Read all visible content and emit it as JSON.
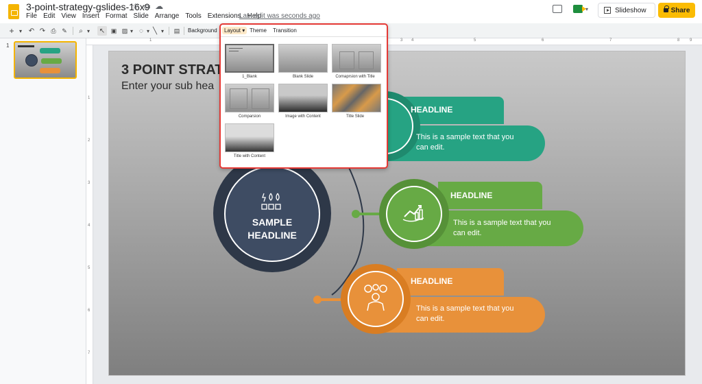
{
  "app": {
    "doc_title": "3-point-strategy-gslides-16x9",
    "menu": [
      "File",
      "Edit",
      "View",
      "Insert",
      "Format",
      "Slide",
      "Arrange",
      "Tools",
      "Extensions",
      "Help"
    ],
    "last_edit": "Last edit was seconds ago",
    "slideshow_label": "Slideshow",
    "share_label": "Share"
  },
  "toolbar": {
    "background_label": "Background",
    "layout_label": "Layout ▾",
    "theme_label": "Theme",
    "transition_label": "Transition"
  },
  "filmstrip": {
    "slide_number": "1"
  },
  "ruler": {
    "top": [
      "1",
      "1",
      "2",
      "3",
      "4",
      "5",
      "6",
      "7",
      "8",
      "9"
    ],
    "left": [
      "1",
      "2",
      "3",
      "4",
      "5",
      "6",
      "7"
    ]
  },
  "slide": {
    "title": "3 POINT STRATE",
    "subtitle": "Enter your sub hea",
    "center_line1": "SAMPLE",
    "center_line2": "HEADLINE",
    "items": [
      {
        "headline": "HEADLINE",
        "line1": "This is a sample text that you",
        "line2": "can edit.",
        "color": "#26a383",
        "dark": "#1f8a6e"
      },
      {
        "headline": "HEADLINE",
        "line1": "This is a sample text that you",
        "line2": "can edit.",
        "color": "#67aa45",
        "dark": "#569138"
      },
      {
        "headline": "HEADLINE",
        "line1": "This is a sample text that you",
        "line2": "can edit.",
        "color": "#e8913a",
        "dark": "#d97d22"
      }
    ]
  },
  "layouts": [
    {
      "name": "1_Blank"
    },
    {
      "name": "Blank Slide"
    },
    {
      "name": "Comaprsion with Title"
    },
    {
      "name": "Comparsion"
    },
    {
      "name": "Image with Content"
    },
    {
      "name": "Title Slide"
    },
    {
      "name": "Title with Content"
    }
  ]
}
